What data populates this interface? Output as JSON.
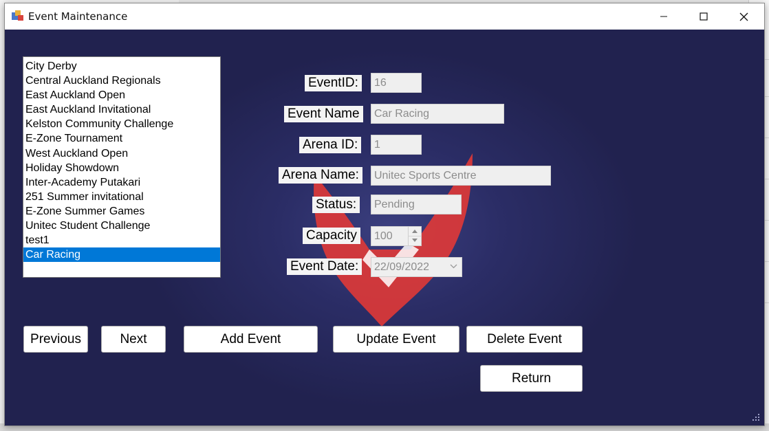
{
  "window": {
    "title": "Event Maintenance"
  },
  "events_list": {
    "items": [
      "City Derby",
      "Central Auckland Regionals",
      "East Auckland Open",
      "East Auckland Invitational",
      "Kelston Community Challenge",
      "E-Zone Tournament",
      "West Auckland Open",
      "Holiday Showdown",
      "Inter-Academy Putakari",
      "251 Summer invitational",
      "E-Zone Summer Games",
      "Unitec Student Challenge",
      "test1",
      "Car Racing"
    ],
    "selected": "Car Racing"
  },
  "form": {
    "event_id": {
      "label": "EventID:",
      "value": "16"
    },
    "event_name": {
      "label": "Event Name",
      "value": "Car Racing"
    },
    "arena_id": {
      "label": "Arena ID:",
      "value": "1"
    },
    "arena_name": {
      "label": "Arena Name:",
      "value": "Unitec Sports Centre"
    },
    "status": {
      "label": "Status:",
      "value": "Pending"
    },
    "capacity": {
      "label": "Capacity",
      "value": "100"
    },
    "event_date": {
      "label": "Event Date:",
      "value": "22/09/2022"
    }
  },
  "buttons": {
    "previous": "Previous",
    "next": "Next",
    "add": "Add Event",
    "update": "Update Event",
    "delete": "Delete Event",
    "return": "Return"
  },
  "colors": {
    "background": "#21224f",
    "selection": "#0078d7",
    "logo": "#e53935"
  }
}
